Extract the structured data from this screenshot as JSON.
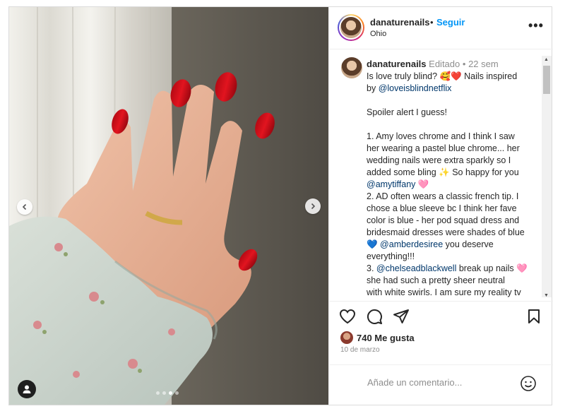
{
  "post": {
    "username": "danaturenails",
    "follow_label": "Seguir",
    "header_separator": "•",
    "location": "Ohio",
    "more_label": "•••"
  },
  "caption": {
    "username": "danaturenails",
    "edited": "Editado",
    "separator": "•",
    "age": "22 sem",
    "lines": [
      {
        "text": "Is love truly blind? 🥰❤️ Nails inspired"
      },
      {
        "pre": "by ",
        "mention": "@loveisblindnetflix"
      },
      {
        "blank": true
      },
      {
        "text": "Spoiler alert I guess!"
      },
      {
        "blank": true
      },
      {
        "text": "1. Amy loves chrome and I think I saw"
      },
      {
        "text": "her wearing a pastel blue chrome... her"
      },
      {
        "text": "wedding nails were extra sparkly so I"
      },
      {
        "text": "added some bling ✨ So happy for you"
      },
      {
        "mention": "@amytiffany",
        "post": " 🩷"
      },
      {
        "text": "2. AD often wears a classic french tip. I"
      },
      {
        "text": "chose a blue sleeve bc I think her fave"
      },
      {
        "text": "color is blue - her pod squad dress and"
      },
      {
        "text": "bridesmaid dresses were shades of blue"
      },
      {
        "pre": "💙 ",
        "mention": "@amberdesiree",
        "post": " you deserve"
      },
      {
        "text": "everything!!!"
      },
      {
        "pre": "3. ",
        "mention": "@chelseadblackwell",
        "post": " break up nails 🩷"
      },
      {
        "text": "she had such a pretty sheer neutral"
      },
      {
        "text": "with white swirls. I am sure my reality tv"
      },
      {
        "text": "                                    🙃"
      }
    ]
  },
  "actions": {
    "like_icon": "heart-icon",
    "comment_icon": "comment-icon",
    "share_icon": "share-icon",
    "save_icon": "bookmark-icon"
  },
  "likes": {
    "text": "740 Me gusta"
  },
  "date": "10 de marzo",
  "comment": {
    "placeholder": "Añade un comentario..."
  },
  "carousel": {
    "slide_count": 4,
    "active_index": 2
  },
  "colors": {
    "link": "#0095f6",
    "mention": "#00376b",
    "text": "#262626",
    "muted": "#8e8e8e"
  }
}
